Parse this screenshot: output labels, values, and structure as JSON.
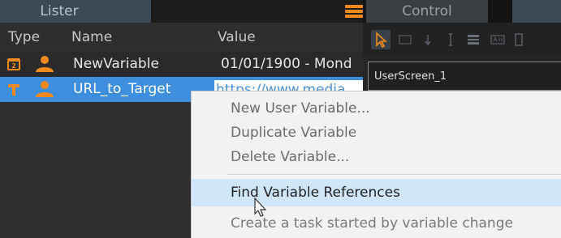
{
  "lister": {
    "title": "Lister",
    "columns": {
      "type": "Type",
      "name": "Name",
      "value": "Value"
    },
    "rows": [
      {
        "type_icon": "date-variable-icon",
        "owner_icon": "user-icon",
        "name": "NewVariable",
        "value": "01/01/1900 - Mond",
        "selected": false
      },
      {
        "type_icon": "text-variable-icon",
        "owner_icon": "user-icon",
        "name": "URL_to_Target",
        "value": "https://www.media",
        "selected": true
      }
    ],
    "menu_icon": "hamburger-icon"
  },
  "control": {
    "title": "Control",
    "screen": "UserScreen_1",
    "tools": [
      "pointer-icon",
      "rectangle-icon",
      "arrow-down-icon",
      "text-cursor-icon",
      "list-icon",
      "label-icon",
      "more-icon"
    ]
  },
  "context_menu": {
    "items": [
      {
        "label": "New User Variable...",
        "highlighted": false
      },
      {
        "label": "Duplicate Variable",
        "highlighted": false
      },
      {
        "label": "Delete Variable...",
        "highlighted": false
      },
      {
        "label": "Find Variable References",
        "highlighted": true
      },
      {
        "label": "Create a task started by variable change",
        "highlighted": false
      }
    ]
  },
  "colors": {
    "selection": "#3d8edc",
    "accent": "#f08a1c",
    "menu_highlight": "#cfe6fb"
  }
}
